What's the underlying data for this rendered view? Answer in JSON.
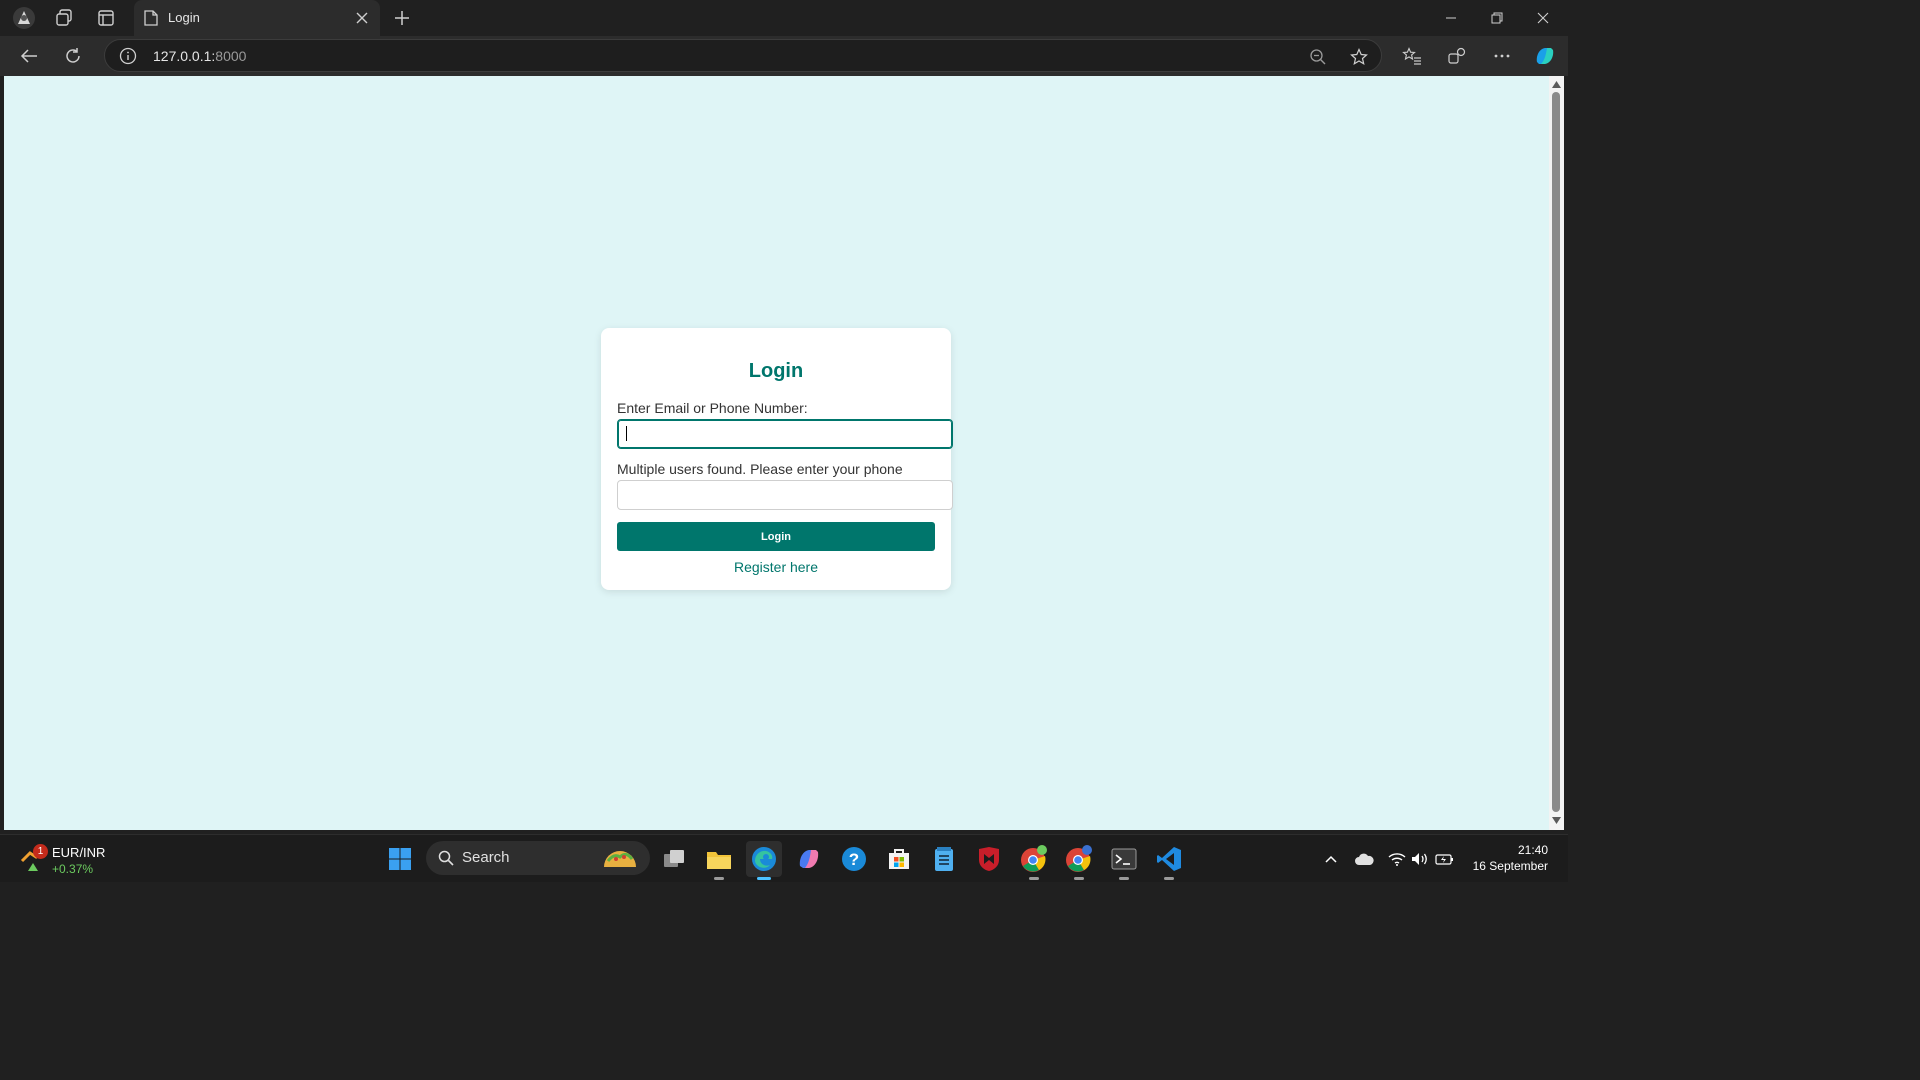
{
  "browser": {
    "tab_title": "Login",
    "url_host": "127.0.0.1:",
    "url_port": "8000"
  },
  "page": {
    "heading": "Login",
    "email_label": "Enter Email or Phone Number:",
    "email_value": "",
    "phone_label": "Multiple users found. Please enter your phone number:",
    "phone_value": "",
    "login_button": "Login",
    "register_link": "Register here",
    "colors": {
      "accent": "#00766c",
      "background": "#dff5f6"
    }
  },
  "taskbar": {
    "widget": {
      "pair": "EUR/INR",
      "change": "+0.37%",
      "badge": "1"
    },
    "search_label": "Search",
    "apps": [
      "task-view",
      "file-explorer",
      "edge",
      "copilot",
      "help",
      "store",
      "notepad",
      "mcafee",
      "chrome-profile-1",
      "chrome-profile-2",
      "terminal",
      "vscode"
    ],
    "clock": {
      "time": "21:40",
      "date": "16 September"
    }
  }
}
